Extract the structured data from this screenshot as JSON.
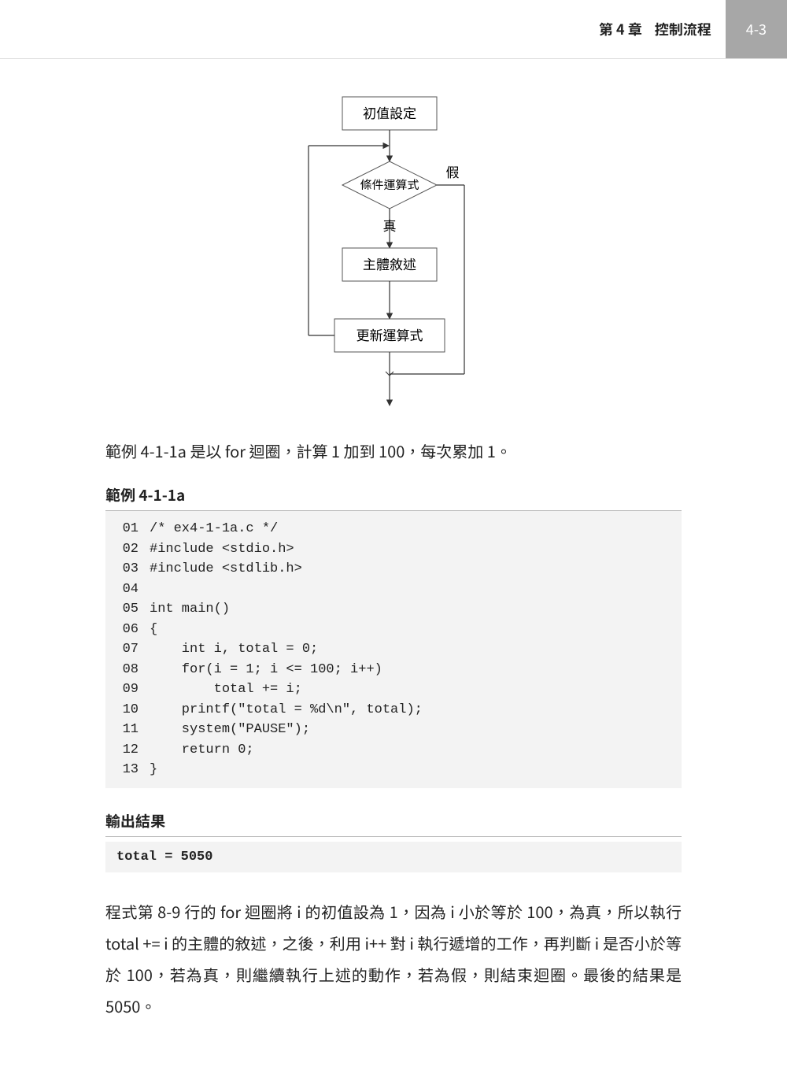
{
  "header": {
    "chapter": "第 4 章",
    "title": "控制流程",
    "pageNum": "4-3"
  },
  "flowchart": {
    "init": "初值設定",
    "cond": "條件運算式",
    "falseLabel": "假",
    "trueLabel": "真",
    "body": "主體敘述",
    "update": "更新運算式"
  },
  "intro": "範例 4-1-1a 是以 for 迴圈，計算 1 加到 100，每次累加 1。",
  "exampleHeading": "範例 4-1-1a",
  "code": [
    {
      "n": "01",
      "t": "/* ex4-1-1a.c */"
    },
    {
      "n": "02",
      "t": "#include <stdio.h>"
    },
    {
      "n": "03",
      "t": "#include <stdlib.h>"
    },
    {
      "n": "04",
      "t": ""
    },
    {
      "n": "05",
      "t": "int main()"
    },
    {
      "n": "06",
      "t": "{"
    },
    {
      "n": "07",
      "t": "    int i, total = 0;"
    },
    {
      "n": "08",
      "t": "    for(i = 1; i <= 100; i++)"
    },
    {
      "n": "09",
      "t": "        total += i;"
    },
    {
      "n": "10",
      "t": "    printf(\"total = %d\\n\", total);"
    },
    {
      "n": "11",
      "t": "    system(\"PAUSE\");"
    },
    {
      "n": "12",
      "t": "    return 0;"
    },
    {
      "n": "13",
      "t": "}"
    }
  ],
  "outputHeading": "輸出結果",
  "output": "total = 5050",
  "bodyPara": "程式第 8-9 行的 for 迴圈將 i 的初值設為 1，因為 i 小於等於 100，為真，所以執行 total += i 的主體的敘述，之後，利用 i++ 對 i 執行遞增的工作，再判斷 i 是否小於等於 100，若為真，則繼續執行上述的動作，若為假，則結束迴圈。最後的結果是 5050。"
}
